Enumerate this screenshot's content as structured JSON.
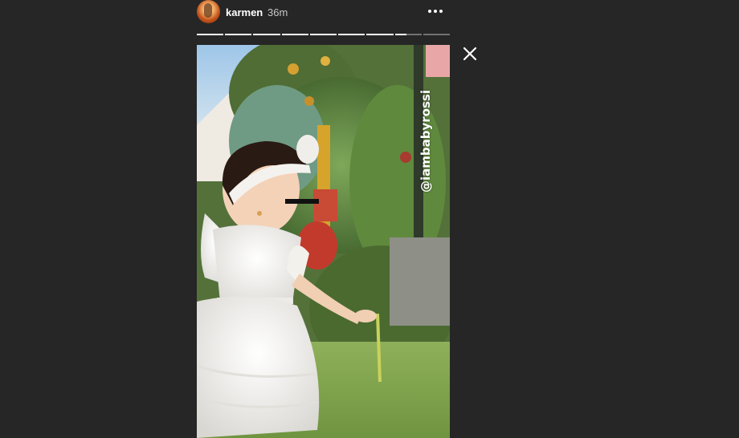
{
  "header": {
    "username": "karmen",
    "time": "36m",
    "avatar_icon": "profile-avatar",
    "more_icon": "more-options-icon"
  },
  "progress": {
    "segments": [
      1,
      1,
      1,
      1,
      1,
      1,
      1,
      0.45,
      0
    ],
    "color_filled": "#ffffff",
    "color_track": "rgba(255,255,255,0.35)"
  },
  "close": {
    "icon": "close-icon"
  },
  "story": {
    "mention": "@iambabyrossi"
  }
}
